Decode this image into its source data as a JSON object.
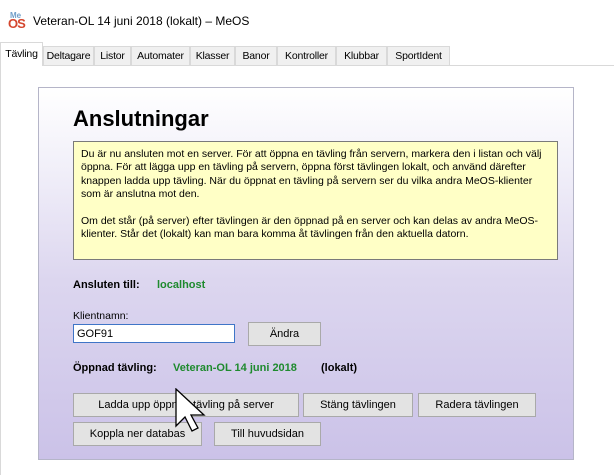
{
  "window": {
    "title": "Veteran-OL 14 juni 2018 (lokalt) – MeOS",
    "icon": "meos-app-icon",
    "icon_text_top": "Me",
    "icon_text_bottom": "OS"
  },
  "tabs": [
    {
      "label": "Tävling",
      "active": true
    },
    {
      "label": "Deltagare",
      "active": false
    },
    {
      "label": "Listor",
      "active": false
    },
    {
      "label": "Automater",
      "active": false
    },
    {
      "label": "Klasser",
      "active": false
    },
    {
      "label": "Banor",
      "active": false
    },
    {
      "label": "Kontroller",
      "active": false
    },
    {
      "label": "Klubbar",
      "active": false
    },
    {
      "label": "SportIdent",
      "active": false
    }
  ],
  "page": {
    "title": "Anslutningar",
    "info_paragraphs": [
      "Du är nu ansluten mot en server. För att öppna en tävling från servern, markera den i listan och välj öppna. För att lägga upp en tävling på servern, öppna först tävlingen lokalt, och använd därefter knappen ladda upp tävling. När du öppnat en tävling på servern ser du vilka andra MeOS-klienter som är anslutna mot den.",
      "Om det står (på server) efter tävlingen är den öppnad på en server och kan delas av andra MeOS-klienter. Står det (lokalt) kan man bara komma åt tävlingen från den aktuella datorn."
    ],
    "connected_label": "Ansluten till:",
    "connected_value": "localhost",
    "client_name_label": "Klientnamn:",
    "client_name_value": "GOF91",
    "change_button": "Ändra",
    "opened_label": "Öppnad tävling:",
    "opened_value": "Veteran-OL 14 juni 2018",
    "opened_mode": "(lokalt)",
    "buttons": {
      "upload": "Ladda upp öppnad tävling på server",
      "close": "Stäng tävlingen",
      "delete": "Radera tävlingen",
      "disconnect": "Koppla ner databas",
      "home": "Till huvudsidan"
    }
  },
  "colors": {
    "accent_green": "#1e8a2e",
    "info_background": "#ffffc6",
    "panel_gradient_end": "#cbc2e8"
  }
}
